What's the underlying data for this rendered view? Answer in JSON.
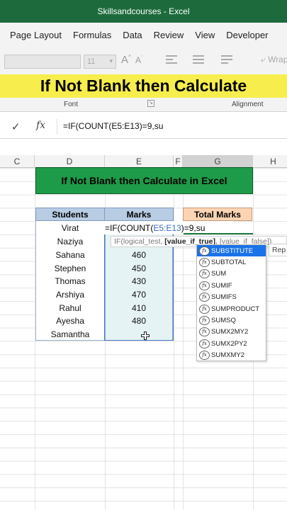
{
  "window": {
    "title": "Skillsandcourses  -  Excel"
  },
  "ribbon": {
    "tabs": [
      "Page Layout",
      "Formulas",
      "Data",
      "Review",
      "View",
      "Developer"
    ],
    "font_size": "11",
    "wrap_label": "Wrap",
    "groups": {
      "font": "Font",
      "alignment": "Alignment"
    }
  },
  "banner": {
    "text": "If Not Blank then Calculate"
  },
  "formula_bar": {
    "content": "=IF(COUNT(E5:E13)=9,su"
  },
  "columns": [
    "C",
    "D",
    "E",
    "F",
    "G",
    "H"
  ],
  "sheet": {
    "title": "If Not Blank then Calculate in Excel",
    "headers": {
      "students": "Students",
      "marks": "Marks",
      "total": "Total Marks"
    },
    "rows": [
      {
        "student": "Virat",
        "marks": ""
      },
      {
        "student": "Naziya",
        "marks": ""
      },
      {
        "student": "Sahana",
        "marks": "460"
      },
      {
        "student": "Stephen",
        "marks": "450"
      },
      {
        "student": "Thomas",
        "marks": "430"
      },
      {
        "student": "Arshiya",
        "marks": "470"
      },
      {
        "student": "Rahul",
        "marks": "410"
      },
      {
        "student": "Ayesha",
        "marks": "480"
      },
      {
        "student": "Samantha",
        "marks": ""
      }
    ],
    "editing": {
      "prefix": "=IF(COUNT(",
      "ref": "E5:E13",
      "suffix": ")=9,su"
    }
  },
  "tooltip": {
    "fn": "IF(logical_test, ",
    "bold_arg": "[value_if_true]",
    "rest": ", [value_if_false])"
  },
  "autocomplete": {
    "items": [
      "SUBSTITUTE",
      "SUBTOTAL",
      "SUM",
      "SUMIF",
      "SUMIFS",
      "SUMPRODUCT",
      "SUMSQ",
      "SUMX2MY2",
      "SUMX2PY2",
      "SUMXMY2"
    ],
    "selected_index": 0,
    "tip": "Rep",
    "icon_glyph": "fx"
  },
  "colors": {
    "title_bar": "#1d6b3d",
    "banner": "#f7ee4d",
    "sheet_title": "#1e9b48",
    "header_blue": "#b8cce4",
    "total_header": "#fbd4b4",
    "selection": "#1a73e8"
  }
}
